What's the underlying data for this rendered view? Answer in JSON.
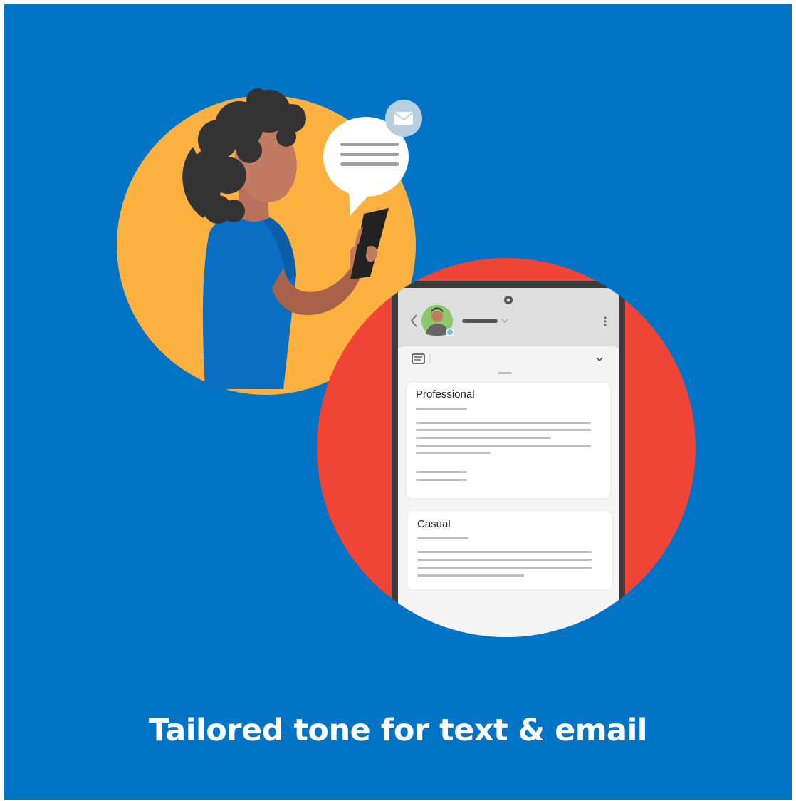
{
  "caption": "Tailored tone for text & email",
  "phone": {
    "options": [
      {
        "label": "Professional"
      },
      {
        "label": "Casual"
      }
    ]
  },
  "icons": {
    "back": "chevron-left-icon",
    "more": "more-vertical-icon",
    "dropdown": "chevron-down-icon",
    "note": "note-icon",
    "mail": "envelope-icon"
  },
  "colors": {
    "background": "#0174c6",
    "yellow_circle": "#fbb040",
    "red_circle": "#f04436",
    "caption_text": "#ffffff"
  }
}
